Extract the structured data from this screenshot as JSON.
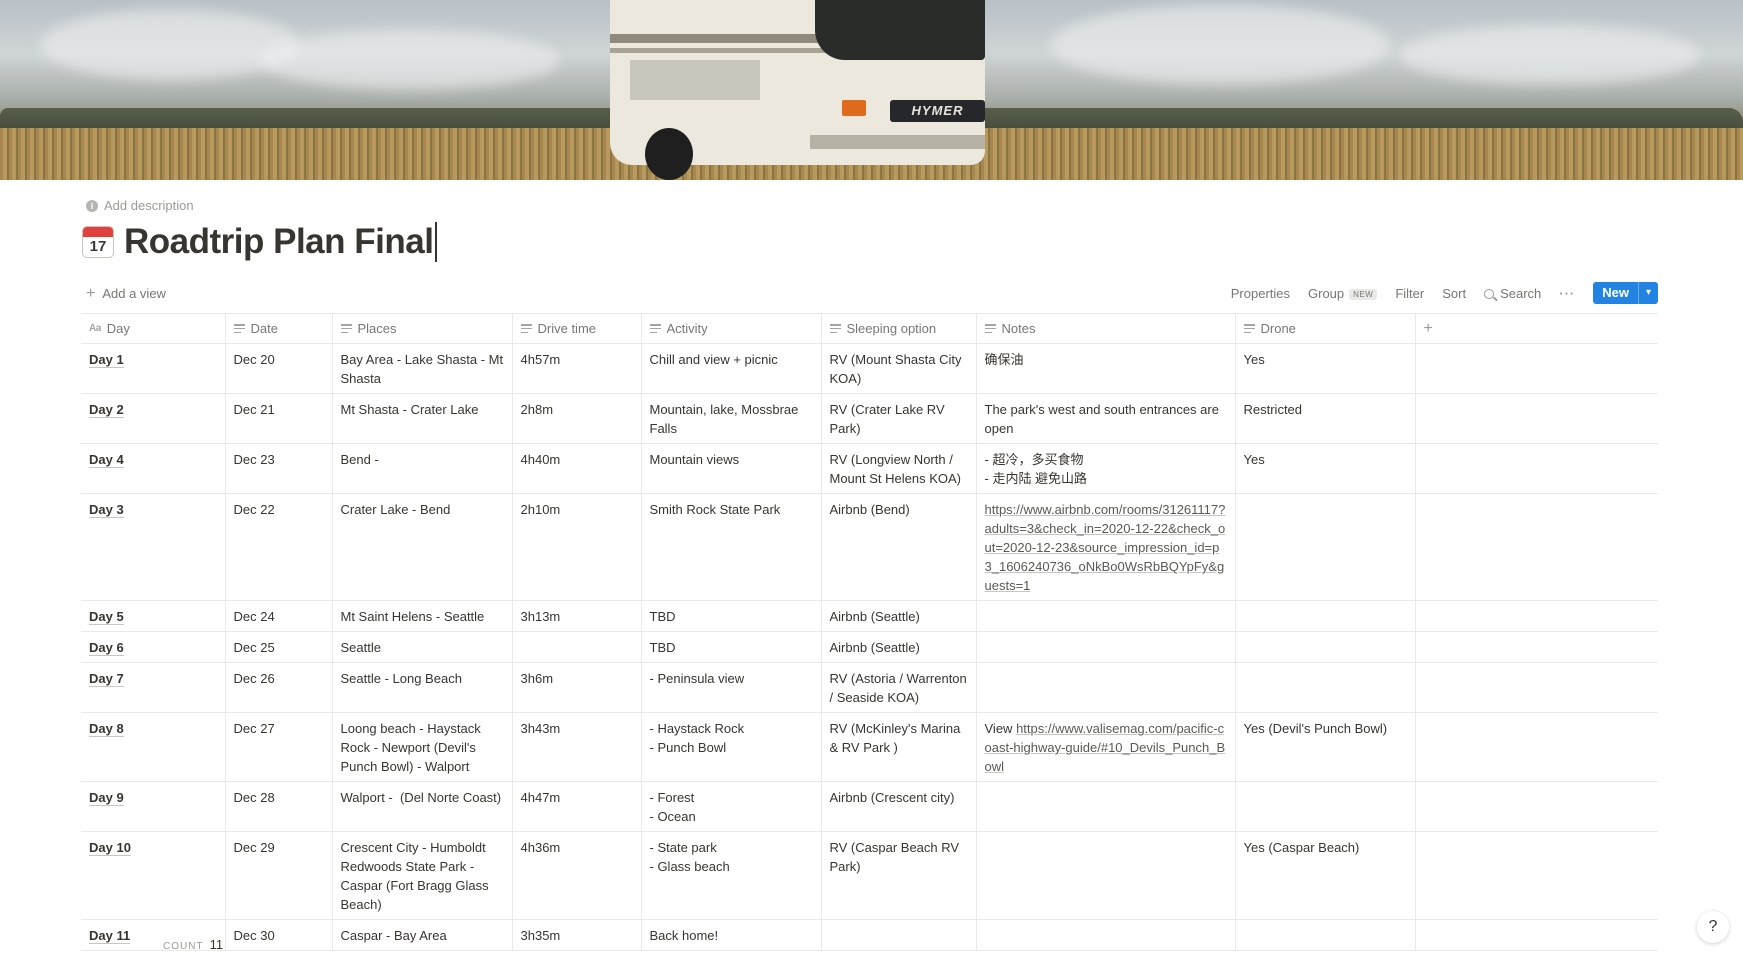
{
  "page": {
    "add_description": "Add description",
    "title": "Roadtrip Plan Final",
    "icon_day": "17"
  },
  "views": {
    "add_view": "Add a view"
  },
  "toolbar": {
    "properties": "Properties",
    "group": "Group",
    "group_badge": "NEW",
    "filter": "Filter",
    "sort": "Sort",
    "search": "Search",
    "more": "···",
    "new": "New",
    "new_caret": "▾"
  },
  "table": {
    "columns": [
      "Day",
      "Date",
      "Places",
      "Drive time",
      "Activity",
      "Sleeping option",
      "Notes",
      "Drone"
    ],
    "rows": [
      {
        "day": "Day 1",
        "date": "Dec 20",
        "places": "Bay Area - Lake Shasta - Mt Shasta",
        "drive": "4h57m",
        "activity": "Chill and view + picnic",
        "sleep": "RV (Mount Shasta City KOA)",
        "notes": "确保油",
        "drone": "Yes"
      },
      {
        "day": "Day 2",
        "date": "Dec 21",
        "places": "Mt Shasta - Crater Lake",
        "drive": "2h8m",
        "activity": "Mountain, lake, Mossbrae Falls",
        "sleep": "RV (Crater Lake RV Park)",
        "notes": "The park's west and south entrances are open",
        "drone": "Restricted"
      },
      {
        "day": "Day 4",
        "date": "Dec 23",
        "places": "Bend -",
        "drive": "4h40m",
        "activity": "Mountain views",
        "sleep": "RV (Longview North / Mount St Helens KOA)",
        "notes": "- 超冷，多买食物\n- 走内陆 避免山路",
        "drone": "Yes"
      },
      {
        "day": "Day 3",
        "date": "Dec 22",
        "places": "Crater Lake - Bend",
        "drive": "2h10m",
        "activity": "Smith Rock State Park",
        "sleep": "Airbnb (Bend)",
        "notes_link": "https://www.airbnb.com/rooms/31261117?adults=3&check_in=2020-12-22&check_out=2020-12-23&source_impression_id=p3_1606240736_oNkBo0WsRbBQYpFy&guests=1",
        "drone": ""
      },
      {
        "day": "Day 5",
        "date": "Dec 24",
        "places": "Mt Saint Helens - Seattle",
        "drive": "3h13m",
        "activity": "TBD",
        "sleep": "Airbnb (Seattle)",
        "notes": "",
        "drone": ""
      },
      {
        "day": "Day 6",
        "date": "Dec 25",
        "places": "Seattle",
        "drive": "",
        "activity": "TBD",
        "sleep": "Airbnb (Seattle)",
        "notes": "",
        "drone": ""
      },
      {
        "day": "Day 7",
        "date": "Dec 26",
        "places": "Seattle - Long Beach",
        "drive": "3h6m",
        "activity": "- Peninsula view",
        "sleep": "RV (Astoria / Warrenton / Seaside KOA)",
        "notes": "",
        "drone": ""
      },
      {
        "day": "Day 8",
        "date": "Dec 27",
        "places": "Loong beach - Haystack Rock - Newport (Devil's Punch Bowl) - Walport",
        "drive": "3h43m",
        "activity": "- Haystack Rock\n- Punch Bowl",
        "sleep": "RV (McKinley's Marina & RV Park )",
        "notes_prefix": "View ",
        "notes_link": "https://www.valisemag.com/pacific-coast-highway-guide/#10_Devils_Punch_Bowl",
        "drone": "Yes (Devil's Punch Bowl)"
      },
      {
        "day": "Day 9",
        "date": "Dec 28",
        "places": "Walport -  (Del Norte Coast)",
        "drive": "4h47m",
        "activity": "- Forest\n- Ocean",
        "sleep": "Airbnb (Crescent city)",
        "notes": "",
        "drone": ""
      },
      {
        "day": "Day 10",
        "date": "Dec 29",
        "places": "Crescent City - Humboldt Redwoods State Park - Caspar (Fort Bragg Glass Beach)",
        "drive": "4h36m",
        "activity": "- State park\n- Glass beach",
        "sleep": "RV (Caspar Beach RV Park)",
        "notes": "",
        "drone": "Yes (Caspar Beach)"
      },
      {
        "day": "Day 11",
        "date": "Dec 30",
        "places": "Caspar - Bay Area",
        "drive": "3h35m",
        "activity": "Back home!",
        "sleep": "",
        "notes": "",
        "drone": ""
      }
    ]
  },
  "footer": {
    "count_label": "COUNT",
    "count_value": "11",
    "help": "?"
  },
  "cover": {
    "van_brand": "HYMER"
  },
  "colors": {
    "accent": "#2383e2",
    "airbnb_red": "#e03e3e"
  }
}
